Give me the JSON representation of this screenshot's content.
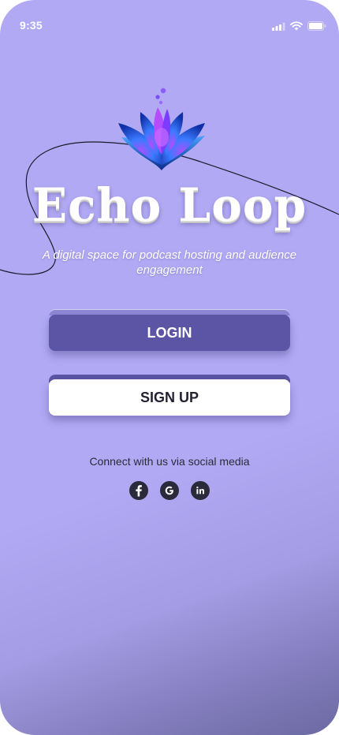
{
  "status_bar": {
    "time": "9:35"
  },
  "app": {
    "title": "Echo Loop",
    "tagline": "A digital space for podcast hosting and audience engagement"
  },
  "buttons": {
    "login": "LOGIN",
    "signup": "SIGN UP"
  },
  "social": {
    "text": "Connect with us via social media",
    "icons": [
      "facebook-icon",
      "google-icon",
      "linkedin-icon"
    ]
  },
  "colors": {
    "background": "#b1a9f3",
    "primary": "#5c55a6",
    "text_dark": "#2b2b3a"
  }
}
